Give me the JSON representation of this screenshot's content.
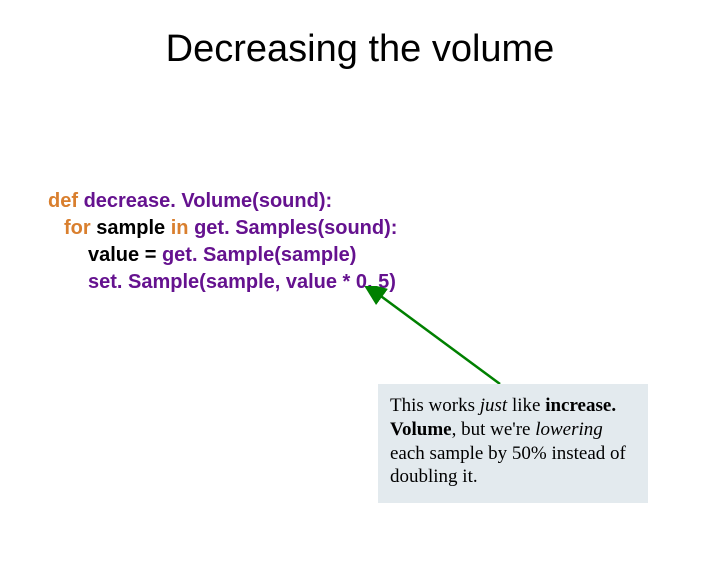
{
  "title": "Decreasing the volume",
  "code": {
    "kw_def": "def",
    "fn_decreaseVolume": "decrease. Volume(sound):",
    "kw_for": "for",
    "txt_sample": "sample",
    "kw_in": "in",
    "fn_getSamples": "get. Samples(sound):",
    "line3_pre": "value = ",
    "fn_getSample": "get. Sample(sample)",
    "fn_setSample": "set. Sample(sample, value * 0. 5)"
  },
  "callout": {
    "t1": "This works ",
    "just": "just",
    "t2": " like ",
    "incVol": "increase. Volume",
    "t3": ", but we're ",
    "lowering": "lowering",
    "t4": " each sample by 50% instead of doubling it."
  }
}
